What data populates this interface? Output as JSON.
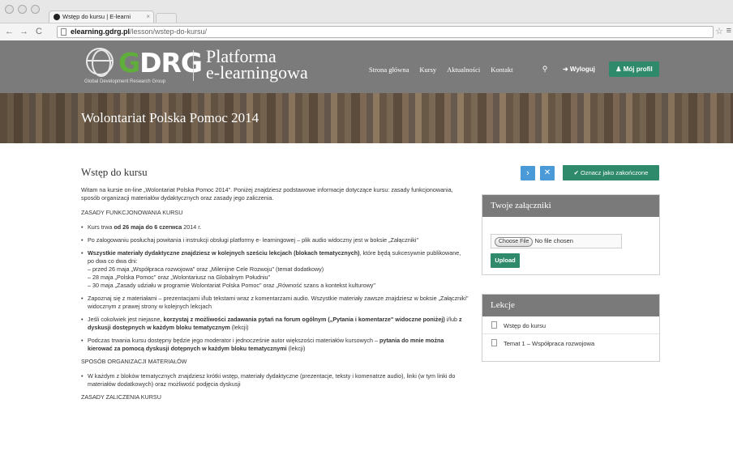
{
  "browser": {
    "tab_title": "Wstęp do kursu | E-learni",
    "tab_close": "×",
    "url_host": "elearning.gdrg.pl",
    "url_path": "/lesson/wstep-do-kursu/"
  },
  "header": {
    "logo_g": "G",
    "logo_rest": "DRG",
    "logo_subtitle": "Global Development Research Group",
    "platform_line1": "Platforma",
    "platform_line2": "e-learningowa",
    "nav": [
      "Strona główna",
      "Kursy",
      "Aktualności",
      "Kontakt"
    ],
    "logout_label": "➜ Wyloguj",
    "profile_label": "♟ Mój profil"
  },
  "banner": {
    "title": "Wolontariat Polska Pomoc 2014"
  },
  "lesson": {
    "title": "Wstęp do kursu",
    "intro": "Witam na kursie on-line „Wolontariat Polska Pomoc 2014\". Poniżej znajdziesz podstawowe informacje dotyczące kursu: zasady funkcjonowania, sposób organizacji materiałów dydaktycznych oraz zasady jego zaliczenia.",
    "section1": "ZASADY FUNKCJONOWANIA KURSU",
    "b1_pre": "Kurs trwa ",
    "b1_bold": "od 26 maja do 6 czerwca",
    "b1_post": " 2014 r.",
    "b2": "Po zalogowaniu posłuchaj powitania i instrukcji obsługi platformy e- learningowej – plik audio widoczny jest w boksie „Załączniki\"",
    "b3_bold": "Wszystkie materiały dydaktyczne znajdziesz w kolejnych sześciu lekcjach (blokach tematycznych)",
    "b3_post": ", które będą sukcesywnie publikowane, po dwa co dwa dni:",
    "b3_l1": "– przed 26 maja „Współpraca rozwojowa\" oraz „Milenijne Cele Rozwoju\" (temat dodatkowy)",
    "b3_l2": "– 28 maja „Polska Pomoc\" oraz „Wolontariusz na Globalnym Południu\"",
    "b3_l3": "– 30 maja „Zasady udziału w programie Wolontariat Polska Pomoc\" oraz „Równość szans a kontekst kulturowy\"",
    "b4": "Zapoznaj się z materiałami – prezentacjami i/lub tekstami wraz z komentarzami audio. Wszystkie materiały zawsze znajdziesz w boksie „Załączniki\" widocznym z prawej strony w kolejnych lekcjach",
    "b5_pre": "Jeśli cokolwiek jest niejasne, ",
    "b5_bold1": "korzystaj z możliwości zadawania pytań na forum ogólnym („Pytania i komentarze\" widoczne poniżej)",
    "b5_mid": "  i/lub ",
    "b5_bold2": "z dyskusji dostępnych w każdym bloku tematycznym",
    "b5_post": " (lekcji)",
    "b6_pre": "Podczas trwania kursu dostępny będzie jego moderator i jednocześnie autor większości materiałów kursowych – ",
    "b6_bold": "pytania do mnie można kierować za pomocą dyskusji dotępnych w każdym bloku tematycznymi",
    "b6_post": " (lekcji)",
    "section2": "SPOSÓB ORGANIZACJI MATERIAŁÓW",
    "b7": "W każdym z bloków tematycznych znajdziesz krótki wstęp, materiały dydaktyczne (prezentacje, teksty i komenatrze audio), linki (w tym linki do materiałów dodatkowych) oraz możliwość podjęcia dyskusji",
    "section3": "ZASADY ZALICZENIA KURSU"
  },
  "actions": {
    "next_label": "›",
    "close_label": "✕",
    "done_label": "✔ Oznacz jako zakończone"
  },
  "attachments": {
    "title": "Twoje załączniki",
    "choose_label": "Choose File",
    "file_status": "No file chosen",
    "upload_label": "Upload"
  },
  "lessons": {
    "title": "Lekcje",
    "items": [
      "Wstęp do kursu",
      "Temat 1 – Współpraca rozwojowa"
    ]
  }
}
